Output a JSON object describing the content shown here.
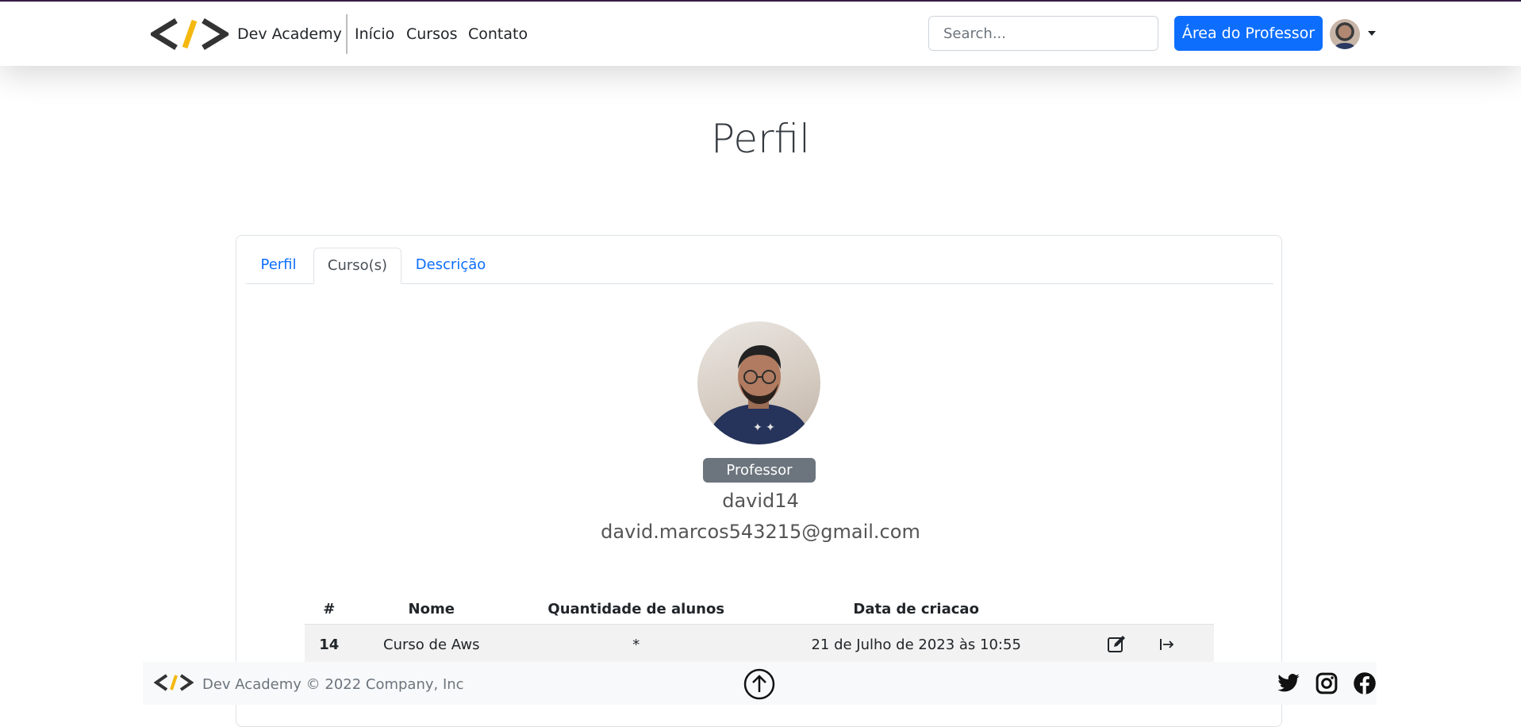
{
  "header": {
    "brand": "Dev Academy",
    "nav": [
      "Início",
      "Cursos",
      "Contato"
    ],
    "search_placeholder": "Search...",
    "teacher_button": "Área do Professor"
  },
  "page": {
    "title": "Perfil"
  },
  "tabs": [
    "Perfil",
    "Curso(s)",
    "Descrição"
  ],
  "profile": {
    "role_badge": "Professor",
    "username": "david14",
    "email": "david.marcos543215@gmail.com"
  },
  "courses_table": {
    "headers": [
      "#",
      "Nome",
      "Quantidade de alunos",
      "Data de criacao"
    ],
    "rows": [
      {
        "id": "14",
        "name": "Curso de Aws",
        "students": "*",
        "created": "21 de Julho de 2023 às 10:55"
      }
    ]
  },
  "footer": {
    "text": "Dev Academy © 2022 Company, Inc"
  },
  "colors": {
    "primary": "#0d6efd",
    "badge": "#6c757d",
    "logo_accent": "#f5b80f",
    "logo_dark": "#333333"
  }
}
